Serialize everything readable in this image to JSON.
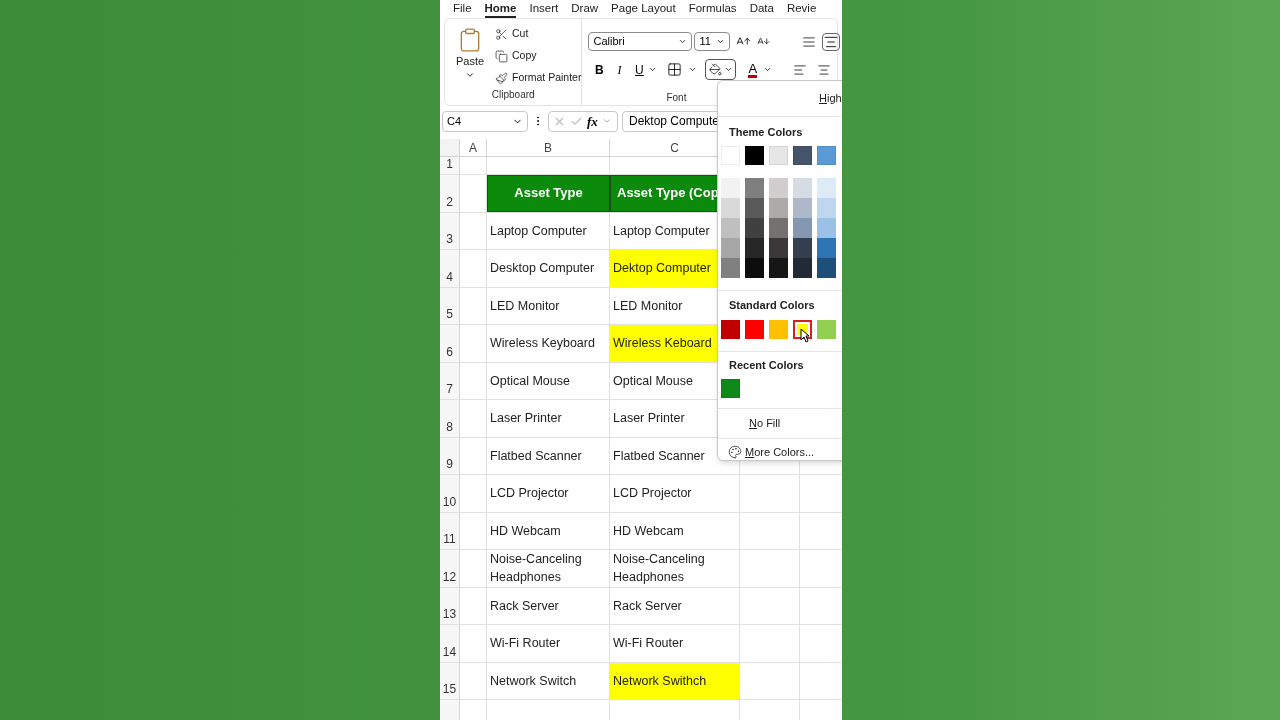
{
  "tabs": [
    {
      "label": "File",
      "selected": false
    },
    {
      "label": "Home",
      "selected": true
    },
    {
      "label": "Insert",
      "selected": false
    },
    {
      "label": "Draw",
      "selected": false
    },
    {
      "label": "Page Layout",
      "selected": false
    },
    {
      "label": "Formulas",
      "selected": false
    },
    {
      "label": "Data",
      "selected": false
    },
    {
      "label": "Revie",
      "selected": false
    }
  ],
  "clipboard": {
    "paste": "Paste",
    "items": [
      {
        "kind": "cut",
        "label": "Cut"
      },
      {
        "kind": "copy",
        "label": "Copy"
      },
      {
        "kind": "painter",
        "label": "Format Painter"
      }
    ],
    "label": "Clipboard"
  },
  "font": {
    "name": "Calibri",
    "size": "11",
    "styles": [
      {
        "kind": "bold",
        "label": "B"
      },
      {
        "kind": "italic",
        "label": "I"
      },
      {
        "kind": "underline",
        "label": "U"
      }
    ],
    "font_color": "A",
    "label": "Font"
  },
  "formula_bar": {
    "name_box": "C4",
    "fx": "fx",
    "value": "Dektop Compute"
  },
  "grid": {
    "columns": [
      "A",
      "B",
      "C"
    ],
    "rows": [
      {
        "number": "1",
        "kind": "blank"
      },
      {
        "number": "2",
        "kind": "header",
        "cells": [
          "Asset Type",
          "Asset Type (Cop"
        ]
      },
      {
        "number": "3",
        "kind": "item",
        "cells": [
          "Laptop Computer",
          "Laptop Computer"
        ],
        "highlighted": false
      },
      {
        "number": "4",
        "kind": "item",
        "cells": [
          "Desktop Computer",
          "Dektop Computer"
        ],
        "highlighted": true
      },
      {
        "number": "5",
        "kind": "item",
        "cells": [
          "LED Monitor",
          "LED Monitor"
        ],
        "highlighted": false
      },
      {
        "number": "6",
        "kind": "item",
        "cells": [
          "Wireless Keyboard",
          "Wireless Keboard"
        ],
        "highlighted": true
      },
      {
        "number": "7",
        "kind": "item",
        "cells": [
          "Optical Mouse",
          "Optical Mouse"
        ],
        "highlighted": false
      },
      {
        "number": "8",
        "kind": "item",
        "cells": [
          "Laser Printer",
          "Laser Printer"
        ],
        "highlighted": false
      },
      {
        "number": "9",
        "kind": "item",
        "cells": [
          "Flatbed Scanner",
          "Flatbed Scanner"
        ],
        "highlighted": false
      },
      {
        "number": "10",
        "kind": "item",
        "cells": [
          "LCD Projector",
          "LCD Projector"
        ],
        "highlighted": false
      },
      {
        "number": "11",
        "kind": "item",
        "cells": [
          "HD Webcam",
          "HD Webcam"
        ],
        "highlighted": false
      },
      {
        "number": "12",
        "kind": "item",
        "cells": [
          "Noise-Canceling Headphones",
          "Noise-Canceling Headphones"
        ],
        "highlighted": false
      },
      {
        "number": "13",
        "kind": "item",
        "cells": [
          "Rack Server",
          "Rack Server"
        ],
        "highlighted": false
      },
      {
        "number": "14",
        "kind": "item",
        "cells": [
          "Wi-Fi Router",
          "Wi-Fi Router"
        ],
        "highlighted": false
      },
      {
        "number": "15",
        "kind": "item",
        "cells": [
          "Network Switch",
          "Network Swithch"
        ],
        "highlighted": true
      }
    ]
  },
  "fill_menu": {
    "title": "High",
    "theme_title": "Theme Colors",
    "theme_top": [
      {
        "color": "#ffffff"
      },
      {
        "color": "#000000"
      },
      {
        "color": "#e7e6e6"
      },
      {
        "color": "#44546a"
      },
      {
        "color": "#5b9bd5"
      }
    ],
    "theme_shades": [
      {
        "shades": [
          {
            "color": "#f2f2f2"
          },
          {
            "color": "#d9d9d9"
          },
          {
            "color": "#bfbfbf"
          },
          {
            "color": "#a6a6a6"
          },
          {
            "color": "#808080"
          }
        ]
      },
      {
        "shades": [
          {
            "color": "#7f7f7f"
          },
          {
            "color": "#595959"
          },
          {
            "color": "#404040"
          },
          {
            "color": "#262626"
          },
          {
            "color": "#0d0d0d"
          }
        ]
      },
      {
        "shades": [
          {
            "color": "#d0cece"
          },
          {
            "color": "#aeaaaa"
          },
          {
            "color": "#757171"
          },
          {
            "color": "#3a3838"
          },
          {
            "color": "#161616"
          }
        ]
      },
      {
        "shades": [
          {
            "color": "#d6dce4"
          },
          {
            "color": "#adb9ca"
          },
          {
            "color": "#8497b0"
          },
          {
            "color": "#333f4f"
          },
          {
            "color": "#222a35"
          }
        ]
      },
      {
        "shades": [
          {
            "color": "#ddebf7"
          },
          {
            "color": "#bdd7ee"
          },
          {
            "color": "#9bc2e6"
          },
          {
            "color": "#2f75b5"
          },
          {
            "color": "#1f4e78"
          }
        ]
      }
    ],
    "standard_title": "Standard Colors",
    "standard": [
      {
        "color": "#c00000",
        "selected": false
      },
      {
        "color": "#ff0000",
        "selected": false
      },
      {
        "color": "#ffc000",
        "selected": false
      },
      {
        "color": "#ffff00",
        "selected": true
      },
      {
        "color": "#92d050",
        "selected": false
      }
    ],
    "recent_title": "Recent Colors",
    "recent": [
      {
        "color": "#0f8a1a"
      }
    ],
    "no_fill": "No Fill",
    "more": "More Colors..."
  }
}
